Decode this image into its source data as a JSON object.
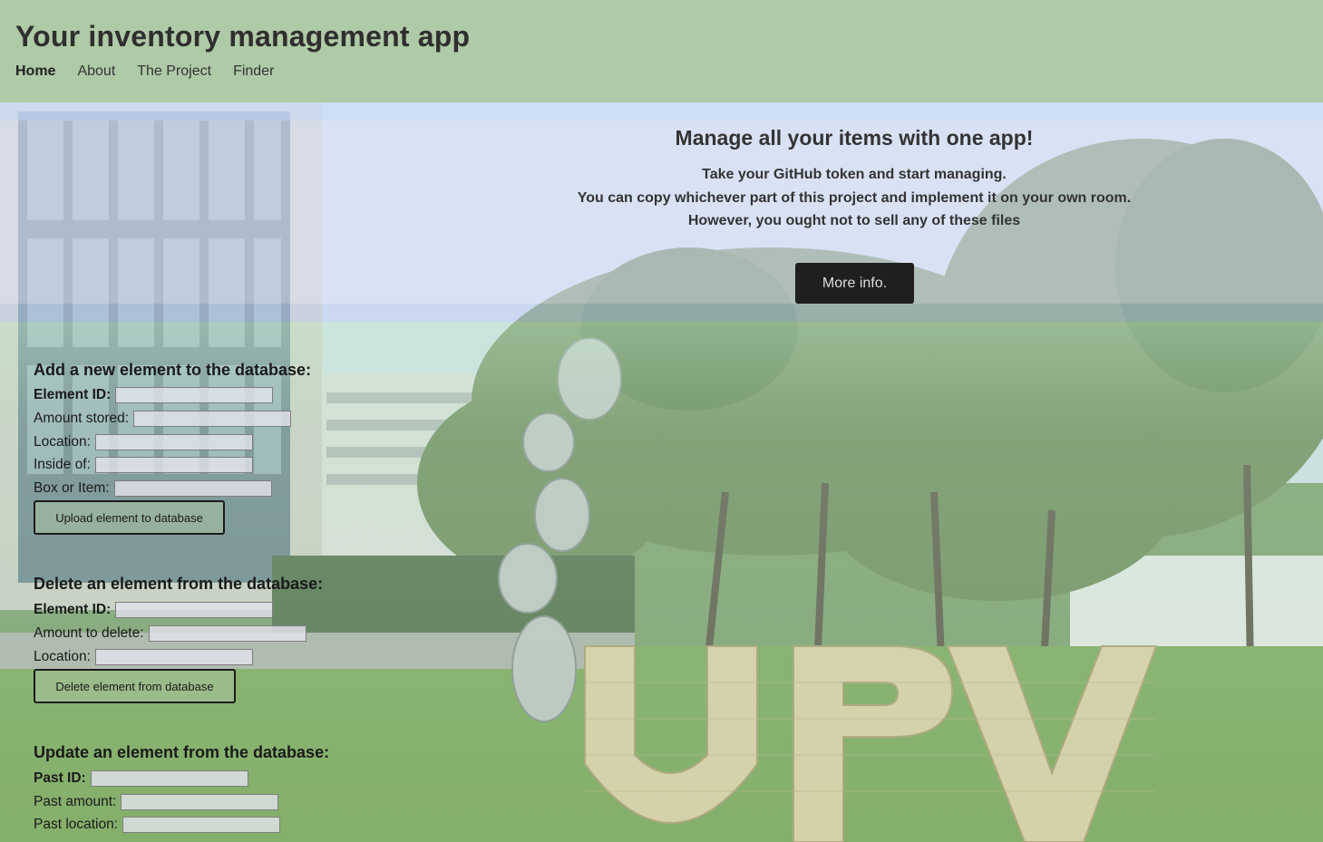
{
  "header": {
    "title": "Your inventory management app",
    "nav": [
      {
        "label": "Home",
        "active": true
      },
      {
        "label": "About",
        "active": false
      },
      {
        "label": "The Project",
        "active": false
      },
      {
        "label": "Finder",
        "active": false
      }
    ]
  },
  "hero": {
    "title": "Manage all your items with one app!",
    "lines": [
      "Take your GitHub token and start managing.",
      "You can copy whichever part of this project and implement it on your own room.",
      "However, you ought not to sell any of these files"
    ],
    "button_label": "More info."
  },
  "add_form": {
    "title": "Add a new element to the database:",
    "fields": {
      "element_id": {
        "label": "Element ID:",
        "value": ""
      },
      "amount": {
        "label": "Amount stored:",
        "value": ""
      },
      "location": {
        "label": "Location:",
        "value": ""
      },
      "inside_of": {
        "label": "Inside of:",
        "value": ""
      },
      "box_or_item": {
        "label": "Box or Item:",
        "value": ""
      }
    },
    "button_label": "Upload element to database"
  },
  "delete_form": {
    "title": "Delete an element from the database:",
    "fields": {
      "element_id": {
        "label": "Element ID:",
        "value": ""
      },
      "amount": {
        "label": "Amount to delete:",
        "value": ""
      },
      "location": {
        "label": "Location:",
        "value": ""
      }
    },
    "button_label": "Delete element from database"
  },
  "update_form": {
    "title": "Update an element from the database:",
    "fields": {
      "past_id": {
        "label": "Past ID:",
        "value": ""
      },
      "past_amount": {
        "label": "Past amount:",
        "value": ""
      },
      "past_location": {
        "label": "Past location:",
        "value": ""
      }
    }
  },
  "background": {
    "sign_text": "UPV"
  }
}
